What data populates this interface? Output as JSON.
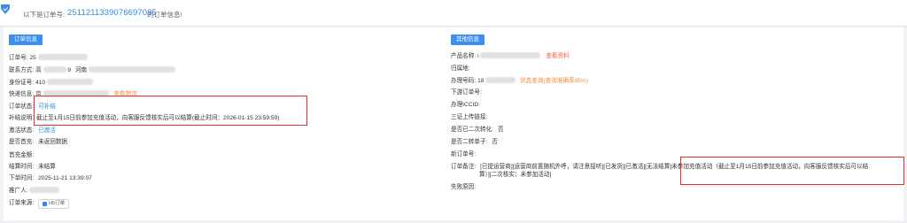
{
  "header": {
    "prefix": "以下是订单号:",
    "order_no": "2511211339076697085",
    "suffix": "的订单信息!"
  },
  "left": {
    "section_title": "订单信息",
    "order_no_label": "订单号:",
    "order_no_value": "25",
    "contact_label": "联系方式:",
    "contact_value_a": "高",
    "contact_value_b": "9",
    "contact_value_c": "河南",
    "id_label": "身份证号:",
    "id_value": "410",
    "express_label": "快递信息:",
    "express_value": "京",
    "express_link": "查看物流",
    "status_label": "订单状态:",
    "status_value": "可补结",
    "note_label": "补结说明:",
    "note_value": "截止至1月15日前参加充值活动，向客服反馈核实后可以结算(截止时间：2026-01-15 23:59:59)",
    "activate_label": "激活状态:",
    "activate_value": "已激活",
    "first_label": "是否首充:",
    "first_value": "未返回数据",
    "first_amount_label": "首充金额:",
    "first_amount_value": "",
    "settle_label": "结算时间:",
    "settle_value": "未结算",
    "order_time_label": "下单时间:",
    "order_time_value": "2025-11-21 13:39:07",
    "promoter_label": "推广人:",
    "source_label": "订单来源:",
    "source_value": "H5订单"
  },
  "right": {
    "section_title": "其他信息",
    "product_label": "产品名称:",
    "product_value": "i",
    "product_link": "查看资料",
    "region_label": "归属地:",
    "phone_label": "办理号码:",
    "phone_value": "18",
    "phone_link": "状态查询(查询准确率95%)",
    "sub_order_label": "下游订单号:",
    "iccid_label": "办理ICCID:",
    "three_label": "三证上传链接:",
    "second_label": "是否已二次转化:",
    "second_value": "否",
    "transfer_label": "是否二转单子:",
    "transfer_value": "否",
    "new_order_label": "新订单号:",
    "remark_label": "订单备注:",
    "remark_line1a": "[已提运营商][运营商前置随机外呼，请注意接听][已发货][已激活][无法结算]",
    "remark_line1b": "未参加充值活动（截止至1月15日前参加充值活动，向客服反馈核实后可以结",
    "remark_line2": "算）][二次核实：未参加活动]",
    "fail_label": "失败原因:"
  },
  "colors": {
    "accent": "#3b8ff0",
    "link_blue": "#2f8be0",
    "link_orange": "#f28a3a",
    "highlight_box": "#ec2b2b"
  }
}
